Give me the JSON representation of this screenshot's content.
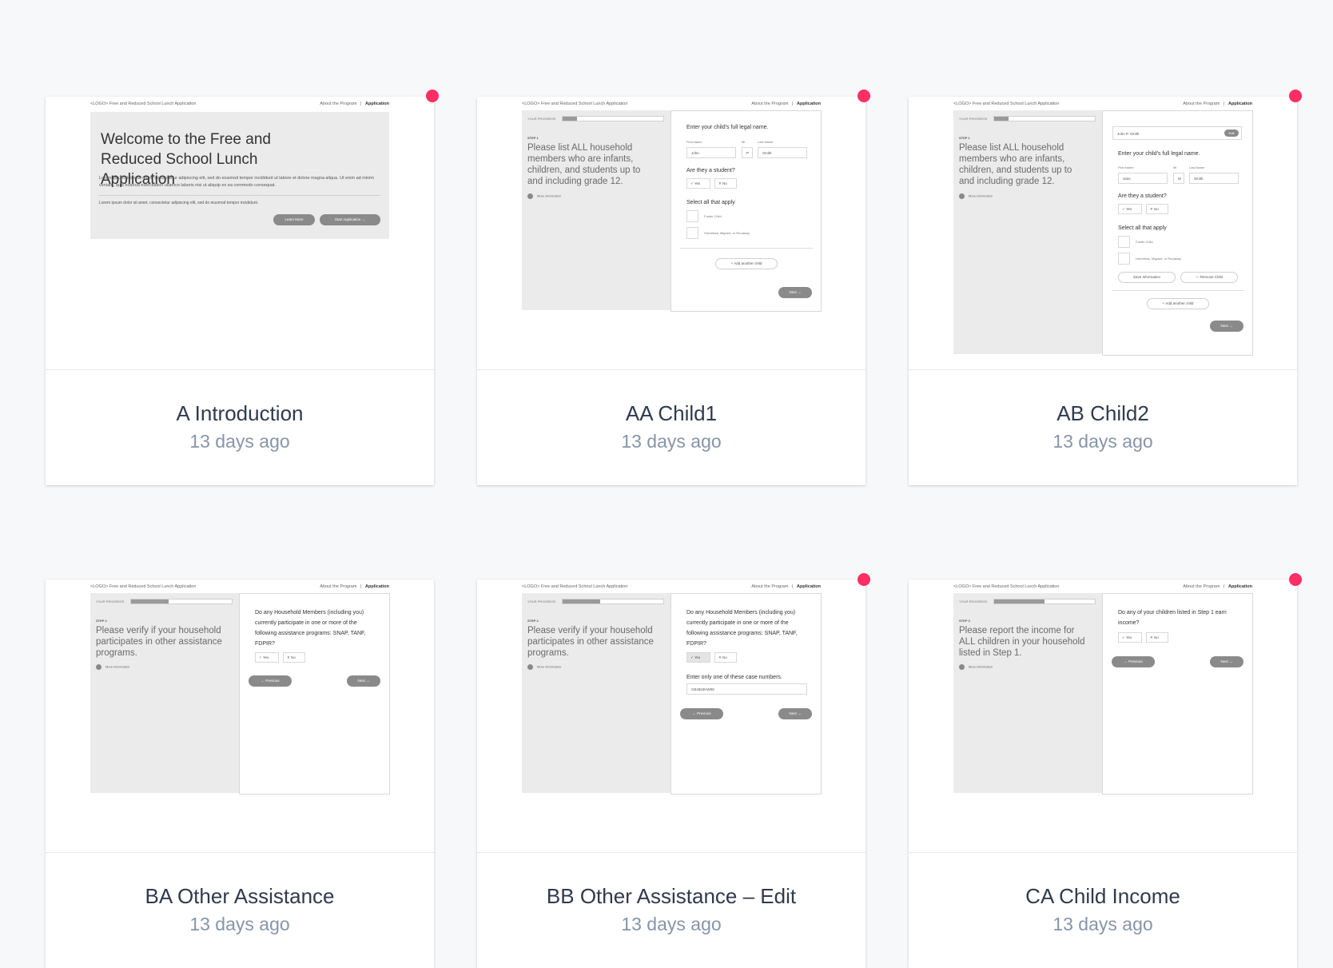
{
  "common": {
    "logo_text": "<LOGO> Free and Reduced School Lunch Application",
    "nav_about": "About the Program",
    "nav_sep": "|",
    "nav_application": "Application",
    "progress_label": "YOUR PROGRESS",
    "more_info": "More information",
    "next": "Next →",
    "previous": "← Previous",
    "yes": "✓  Yes",
    "no": "✕  No"
  },
  "cards": [
    {
      "title": "A Introduction",
      "date": "13 days ago",
      "heading": "Welcome to the Free and Reduced School Lunch Application",
      "para1": "Lorem ipsum dolor sit amet, consectetur adipiscing elit, sed do eiusmod tempor incididunt ut labore et dolore magna aliqua. Ut enim ad minim veniam, quis nostrud exercitation ullamco laboris nisi ut aliquip ex ea commodo consequat.",
      "para2": "Lorem ipsum dolor sit amet, consectetur adipiscing elit, sed do eiusmod tempor incididunt.",
      "learn_more": "Learn More",
      "start": "Start Application →"
    },
    {
      "title": "AA Child1",
      "date": "13 days ago",
      "step": "STEP 1",
      "question": "Please list ALL household members who are infants, children, and students up to and including grade 12.",
      "enter_name": "Enter your child's full legal name.",
      "first_label": "First Name",
      "mi_label": "MI",
      "last_label": "Last Name",
      "first_value": "John",
      "mi_value": "P",
      "last_value": "Smith",
      "student_q": "Are they a student?",
      "select_all": "Select all that apply",
      "opt1": "Foster Child",
      "opt2": "Homeless, Migrant, or Runaway",
      "add_child": "+  Add another child"
    },
    {
      "title": "AB Child2",
      "date": "13 days ago",
      "step": "STEP 1",
      "question": "Please list ALL household members who are infants, children, and students up to and including grade 12.",
      "saved_child": "John P. Smith",
      "edit": "Edit",
      "enter_name": "Enter your child's full legal name.",
      "first_label": "First Name",
      "mi_label": "MI",
      "last_label": "Last Name",
      "first_value": "Jane",
      "mi_value": "M",
      "last_value": "Smith",
      "student_q": "Are they a student?",
      "select_all": "Select all that apply",
      "opt1": "Foster Child",
      "opt2": "Homeless, Migrant, or Runaway",
      "save_info": "Save Information",
      "remove_child": "—  Remove Child",
      "add_child": "+  Add another child"
    },
    {
      "title": "BA Other Assistance",
      "date": "13 days ago",
      "step": "STEP 2",
      "question": "Please verify if your household participates in other assistance programs.",
      "q_text": "Do any Household Members (including you) currently participate in one or more of the following assistance programs: SNAP, TANF, FDPIR?"
    },
    {
      "title": "BB Other Assistance – Edit",
      "date": "13 days ago",
      "step": "STEP 2",
      "question": "Please verify if your household participates in other assistance programs.",
      "q_text": "Do any Household Members (including you) currently participate in one or more of the following assistance programs: SNAP, TANF, FDPIR?",
      "case_label": "Enter only one of these case numbers.",
      "case_value": "CB4563HW05"
    },
    {
      "title": "CA Child Income",
      "date": "13 days ago",
      "step": "STEP 3",
      "question": "Please report the income for ALL children in your household listed in Step 1.",
      "q_text": "Do any of your children listed in Step 1 earn income?"
    }
  ],
  "colors": {
    "background": "#f7f8fa",
    "accent_dot": "#ff2e63",
    "title": "#2f3a4d",
    "date": "#8795aa"
  }
}
